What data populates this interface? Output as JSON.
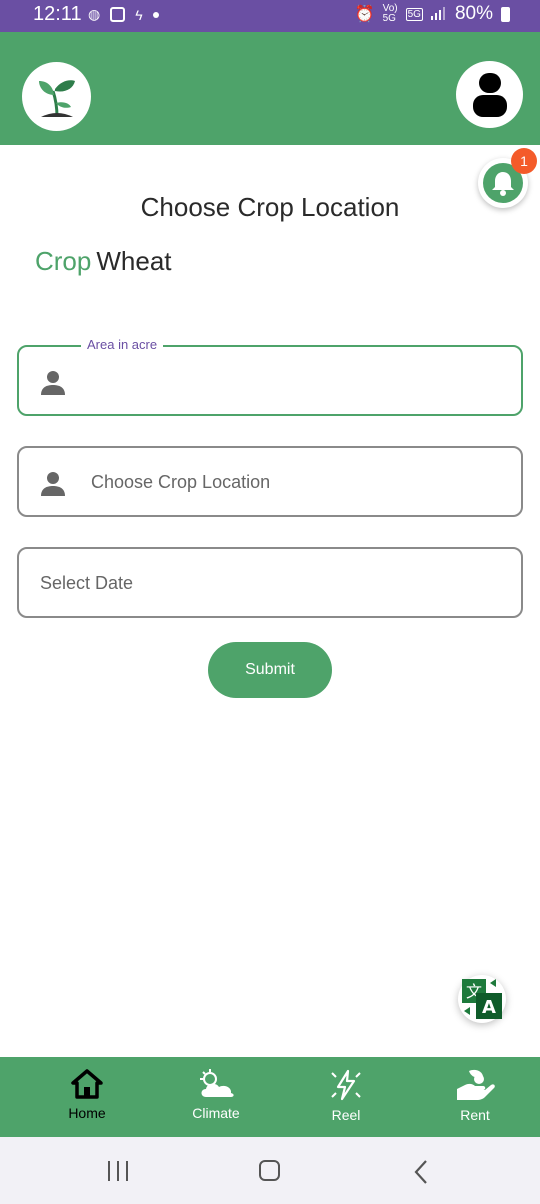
{
  "status_bar": {
    "time": "12:11",
    "network_top": "Vo)",
    "network_bottom": "5G",
    "network_badge": "5G",
    "battery": "80%"
  },
  "page": {
    "title": "Choose Crop Location",
    "crop_label": "Crop",
    "crop_value": "Wheat"
  },
  "notification": {
    "count": "1"
  },
  "form": {
    "area_legend": "Area in acre",
    "area_value": "",
    "location_placeholder": "Choose Crop Location",
    "date_placeholder": "Select Date",
    "submit_label": "Submit"
  },
  "bottom_nav": {
    "items": [
      {
        "label": "Home",
        "icon": "home-icon",
        "active": true
      },
      {
        "label": "Climate",
        "icon": "cloud-sun-icon",
        "active": false
      },
      {
        "label": "Reel",
        "icon": "lightning-icon",
        "active": false
      },
      {
        "label": "Rent",
        "icon": "hand-icon",
        "active": false
      }
    ]
  },
  "colors": {
    "primary_green": "#4ea36a",
    "status_bar": "#6a4fa3",
    "badge": "#f45b2a",
    "legend_text": "#6a4fa3"
  }
}
